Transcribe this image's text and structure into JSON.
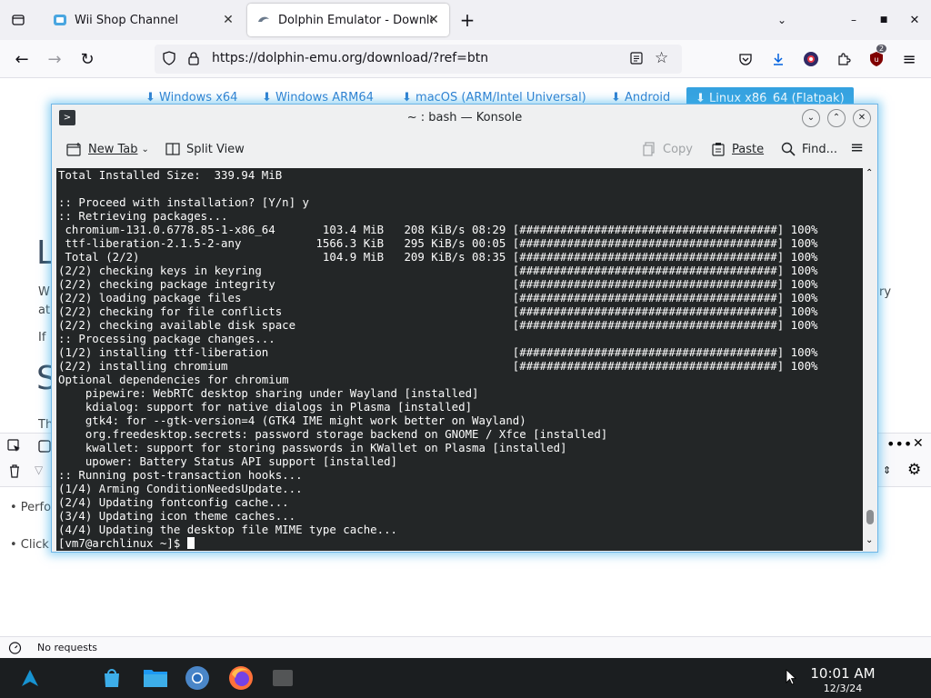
{
  "browser": {
    "tabs": [
      {
        "label": "Wii Shop Channel",
        "active": false
      },
      {
        "label": "Dolphin Emulator - Download",
        "active": true
      }
    ],
    "url": "https://dolphin-emu.org/download/?ref=btn",
    "extension_badge": "2"
  },
  "page": {
    "download_buttons": [
      "⬇ Windows x64",
      "⬇ Windows ARM64",
      "⬇ macOS (ARM/Intel Universal)",
      "⬇ Android",
      "⬇ Linux x86_64 (Flatpak)"
    ],
    "fragments": {
      "l_heading": "L",
      "s_heading": "S",
      "w_text": "W",
      "at_text": "at",
      "if_text": "If",
      "th_text": "Th",
      "ry_text": "ry",
      "perfo": "• Perfo",
      "click": "• Click c"
    },
    "status": "No requests"
  },
  "konsole": {
    "title": "~ : bash — Konsole",
    "toolbar": {
      "new_tab": "New Tab",
      "split_view": "Split View",
      "copy": "Copy",
      "paste": "Paste",
      "find": "Find..."
    },
    "lines": [
      "Total Installed Size:  339.94 MiB",
      "",
      ":: Proceed with installation? [Y/n] y",
      ":: Retrieving packages...",
      " chromium-131.0.6778.85-1-x86_64       103.4 MiB   208 KiB/s 08:29 [######################################] 100%",
      " ttf-liberation-2.1.5-2-any           1566.3 KiB   295 KiB/s 00:05 [######################################] 100%",
      " Total (2/2)                           104.9 MiB   209 KiB/s 08:35 [######################################] 100%",
      "(2/2) checking keys in keyring                                     [######################################] 100%",
      "(2/2) checking package integrity                                   [######################################] 100%",
      "(2/2) loading package files                                        [######################################] 100%",
      "(2/2) checking for file conflicts                                  [######################################] 100%",
      "(2/2) checking available disk space                                [######################################] 100%",
      ":: Processing package changes...",
      "(1/2) installing ttf-liberation                                    [######################################] 100%",
      "(2/2) installing chromium                                          [######################################] 100%",
      "Optional dependencies for chromium",
      "    pipewire: WebRTC desktop sharing under Wayland [installed]",
      "    kdialog: support for native dialogs in Plasma [installed]",
      "    gtk4: for --gtk-version=4 (GTK4 IME might work better on Wayland)",
      "    org.freedesktop.secrets: password storage backend on GNOME / Xfce [installed]",
      "    kwallet: support for storing passwords in KWallet on Plasma [installed]",
      "    upower: Battery Status API support [installed]",
      ":: Running post-transaction hooks...",
      "(1/4) Arming ConditionNeedsUpdate...",
      "(2/4) Updating fontconfig cache...",
      "(3/4) Updating icon theme caches...",
      "(4/4) Updating the desktop file MIME type cache..."
    ],
    "prompt": "[vm7@archlinux ~]$ "
  },
  "taskbar": {
    "time": "10:01 AM",
    "date": "12/3/24"
  },
  "colors": {
    "accent": "#3daee9",
    "terminal_bg": "#232627",
    "terminal_fg": "#fcfcfc",
    "taskbar_bg": "#1b1e20"
  }
}
